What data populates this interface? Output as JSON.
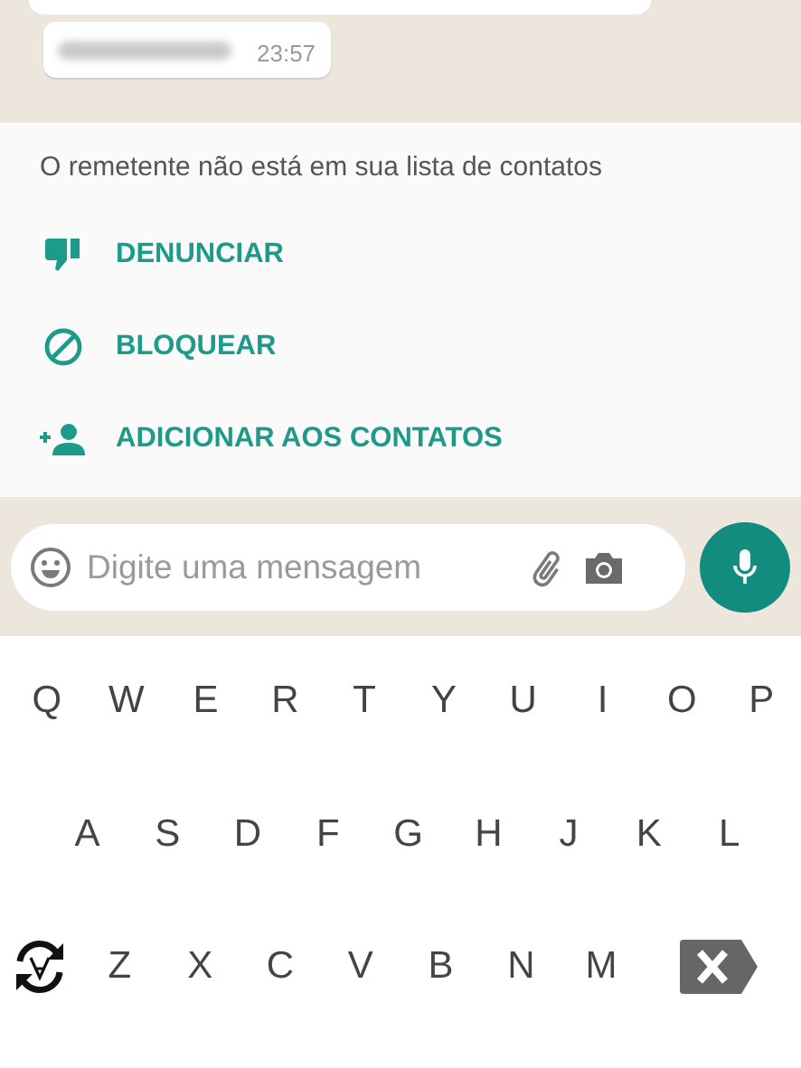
{
  "chat": {
    "messages": [
      {
        "time": "23:57"
      }
    ]
  },
  "unknown_sender": {
    "notice": "O remetente não está em sua lista de contatos",
    "actions": [
      {
        "kind": "report",
        "label": "DENUNCIAR"
      },
      {
        "kind": "block",
        "label": "BLOQUEAR"
      },
      {
        "kind": "add_contact",
        "label": "ADICIONAR AOS CONTATOS"
      }
    ]
  },
  "composer": {
    "placeholder": "Digite uma mensagem"
  },
  "keyboard": {
    "rows": [
      [
        "Q",
        "W",
        "E",
        "R",
        "T",
        "Y",
        "U",
        "I",
        "O",
        "P"
      ],
      [
        "A",
        "S",
        "D",
        "F",
        "G",
        "H",
        "J",
        "K",
        "L"
      ],
      [
        "Z",
        "X",
        "C",
        "V",
        "B",
        "N",
        "M"
      ]
    ]
  }
}
